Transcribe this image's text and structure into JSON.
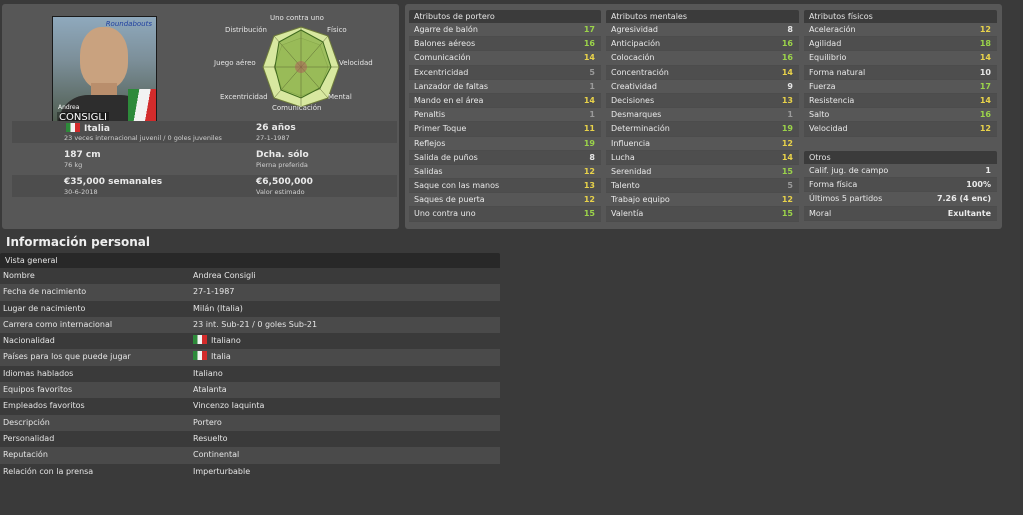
{
  "profile": {
    "photo_first_name": "Andrea",
    "photo_last_name": "CONSIGLI",
    "photo_logo": "Roundabouts",
    "radar_labels": {
      "top": "Uno contra uno",
      "top_left": "Distribución",
      "top_right": "Físico",
      "left": "Juego aéreo",
      "right": "Velocidad",
      "bottom_left": "Excentricidad",
      "bottom_right": "Mental",
      "bottom": "Comunicación"
    },
    "nationality": "Italia",
    "caps": "23 veces internacional juvenil / 0 goles juveniles",
    "age": "26 años",
    "dob": "27-1-1987",
    "height": "187 cm",
    "weight": "76 kg",
    "foot": "Dcha. sólo",
    "foot_label": "Pierna preferida",
    "wage": "€35,000 semanales",
    "contract": "30-6-2018",
    "value": "€6,500,000",
    "value_label": "Valor estimado"
  },
  "goalkeeper": {
    "title": "Atributos de portero",
    "rows": [
      {
        "name": "Agarre de balón",
        "value": "17",
        "color": "#9bd34a"
      },
      {
        "name": "Balones aéreos",
        "value": "16",
        "color": "#9bd34a"
      },
      {
        "name": "Comunicación",
        "value": "14",
        "color": "#e8d24a"
      },
      {
        "name": "Excentricidad",
        "value": "5",
        "color": "#9a9a9a"
      },
      {
        "name": "Lanzador de faltas",
        "value": "1",
        "color": "#9a9a9a"
      },
      {
        "name": "Mando en el área",
        "value": "14",
        "color": "#e8d24a"
      },
      {
        "name": "Penaltis",
        "value": "1",
        "color": "#9a9a9a"
      },
      {
        "name": "Primer Toque",
        "value": "11",
        "color": "#e8d24a"
      },
      {
        "name": "Reflejos",
        "value": "19",
        "color": "#9bd34a"
      },
      {
        "name": "Salida de puños",
        "value": "8",
        "color": "#e6e6e6"
      },
      {
        "name": "Salidas",
        "value": "12",
        "color": "#e8d24a"
      },
      {
        "name": "Saque con las manos",
        "value": "13",
        "color": "#e8d24a"
      },
      {
        "name": "Saques de puerta",
        "value": "12",
        "color": "#e8d24a"
      },
      {
        "name": "Uno contra uno",
        "value": "15",
        "color": "#9bd34a"
      }
    ]
  },
  "mental": {
    "title": "Atributos mentales",
    "rows": [
      {
        "name": "Agresividad",
        "value": "8",
        "color": "#e6e6e6"
      },
      {
        "name": "Anticipación",
        "value": "16",
        "color": "#9bd34a"
      },
      {
        "name": "Colocación",
        "value": "16",
        "color": "#9bd34a"
      },
      {
        "name": "Concentración",
        "value": "14",
        "color": "#e8d24a"
      },
      {
        "name": "Creatividad",
        "value": "9",
        "color": "#e6e6e6"
      },
      {
        "name": "Decisiones",
        "value": "13",
        "color": "#e8d24a"
      },
      {
        "name": "Desmarques",
        "value": "1",
        "color": "#9a9a9a"
      },
      {
        "name": "Determinación",
        "value": "19",
        "color": "#9bd34a"
      },
      {
        "name": "Influencia",
        "value": "12",
        "color": "#e8d24a"
      },
      {
        "name": "Lucha",
        "value": "14",
        "color": "#e8d24a"
      },
      {
        "name": "Serenidad",
        "value": "15",
        "color": "#9bd34a"
      },
      {
        "name": "Talento",
        "value": "5",
        "color": "#9a9a9a"
      },
      {
        "name": "Trabajo equipo",
        "value": "12",
        "color": "#e8d24a"
      },
      {
        "name": "Valentía",
        "value": "15",
        "color": "#9bd34a"
      }
    ]
  },
  "physical": {
    "title": "Atributos físicos",
    "rows": [
      {
        "name": "Aceleración",
        "value": "12",
        "color": "#e8d24a"
      },
      {
        "name": "Agilidad",
        "value": "18",
        "color": "#9bd34a"
      },
      {
        "name": "Equilibrio",
        "value": "14",
        "color": "#e8d24a"
      },
      {
        "name": "Forma natural",
        "value": "10",
        "color": "#e6e6e6"
      },
      {
        "name": "Fuerza",
        "value": "17",
        "color": "#9bd34a"
      },
      {
        "name": "Resistencia",
        "value": "14",
        "color": "#e8d24a"
      },
      {
        "name": "Salto",
        "value": "16",
        "color": "#9bd34a"
      },
      {
        "name": "Velocidad",
        "value": "12",
        "color": "#e8d24a"
      }
    ]
  },
  "others": {
    "title": "Otros",
    "rows": [
      {
        "name": "Calif. jug. de campo",
        "value": "1"
      },
      {
        "name": "Forma física",
        "value": "100%"
      },
      {
        "name": "Últimos 5 partidos",
        "value": "7.26 (4 enc)"
      },
      {
        "name": "Moral",
        "value": "Exultante"
      }
    ]
  },
  "personal": {
    "title": "Información personal",
    "header": "Vista general",
    "rows": [
      {
        "key": "Nombre",
        "value": "Andrea Consigli",
        "flag": false
      },
      {
        "key": "Fecha de nacimiento",
        "value": "27-1-1987",
        "flag": false
      },
      {
        "key": "Lugar de nacimiento",
        "value": "Milán (Italia)",
        "flag": false
      },
      {
        "key": "Carrera como internacional",
        "value": "23 int. Sub-21 / 0 goles Sub-21",
        "flag": false
      },
      {
        "key": "Nacionalidad",
        "value": "Italiano",
        "flag": true
      },
      {
        "key": "Países para los que puede jugar",
        "value": "Italia",
        "flag": true
      },
      {
        "key": "Idiomas hablados",
        "value": "Italiano",
        "flag": false
      },
      {
        "key": "Equipos favoritos",
        "value": "Atalanta",
        "flag": false
      },
      {
        "key": "Empleados favoritos",
        "value": "Vincenzo Iaquinta",
        "flag": false
      },
      {
        "key": "Descripción",
        "value": "Portero",
        "flag": false
      },
      {
        "key": "Personalidad",
        "value": "Resuelto",
        "flag": false
      },
      {
        "key": "Reputación",
        "value": "Continental",
        "flag": false
      },
      {
        "key": "Relación con la prensa",
        "value": "Imperturbable",
        "flag": false
      }
    ]
  }
}
